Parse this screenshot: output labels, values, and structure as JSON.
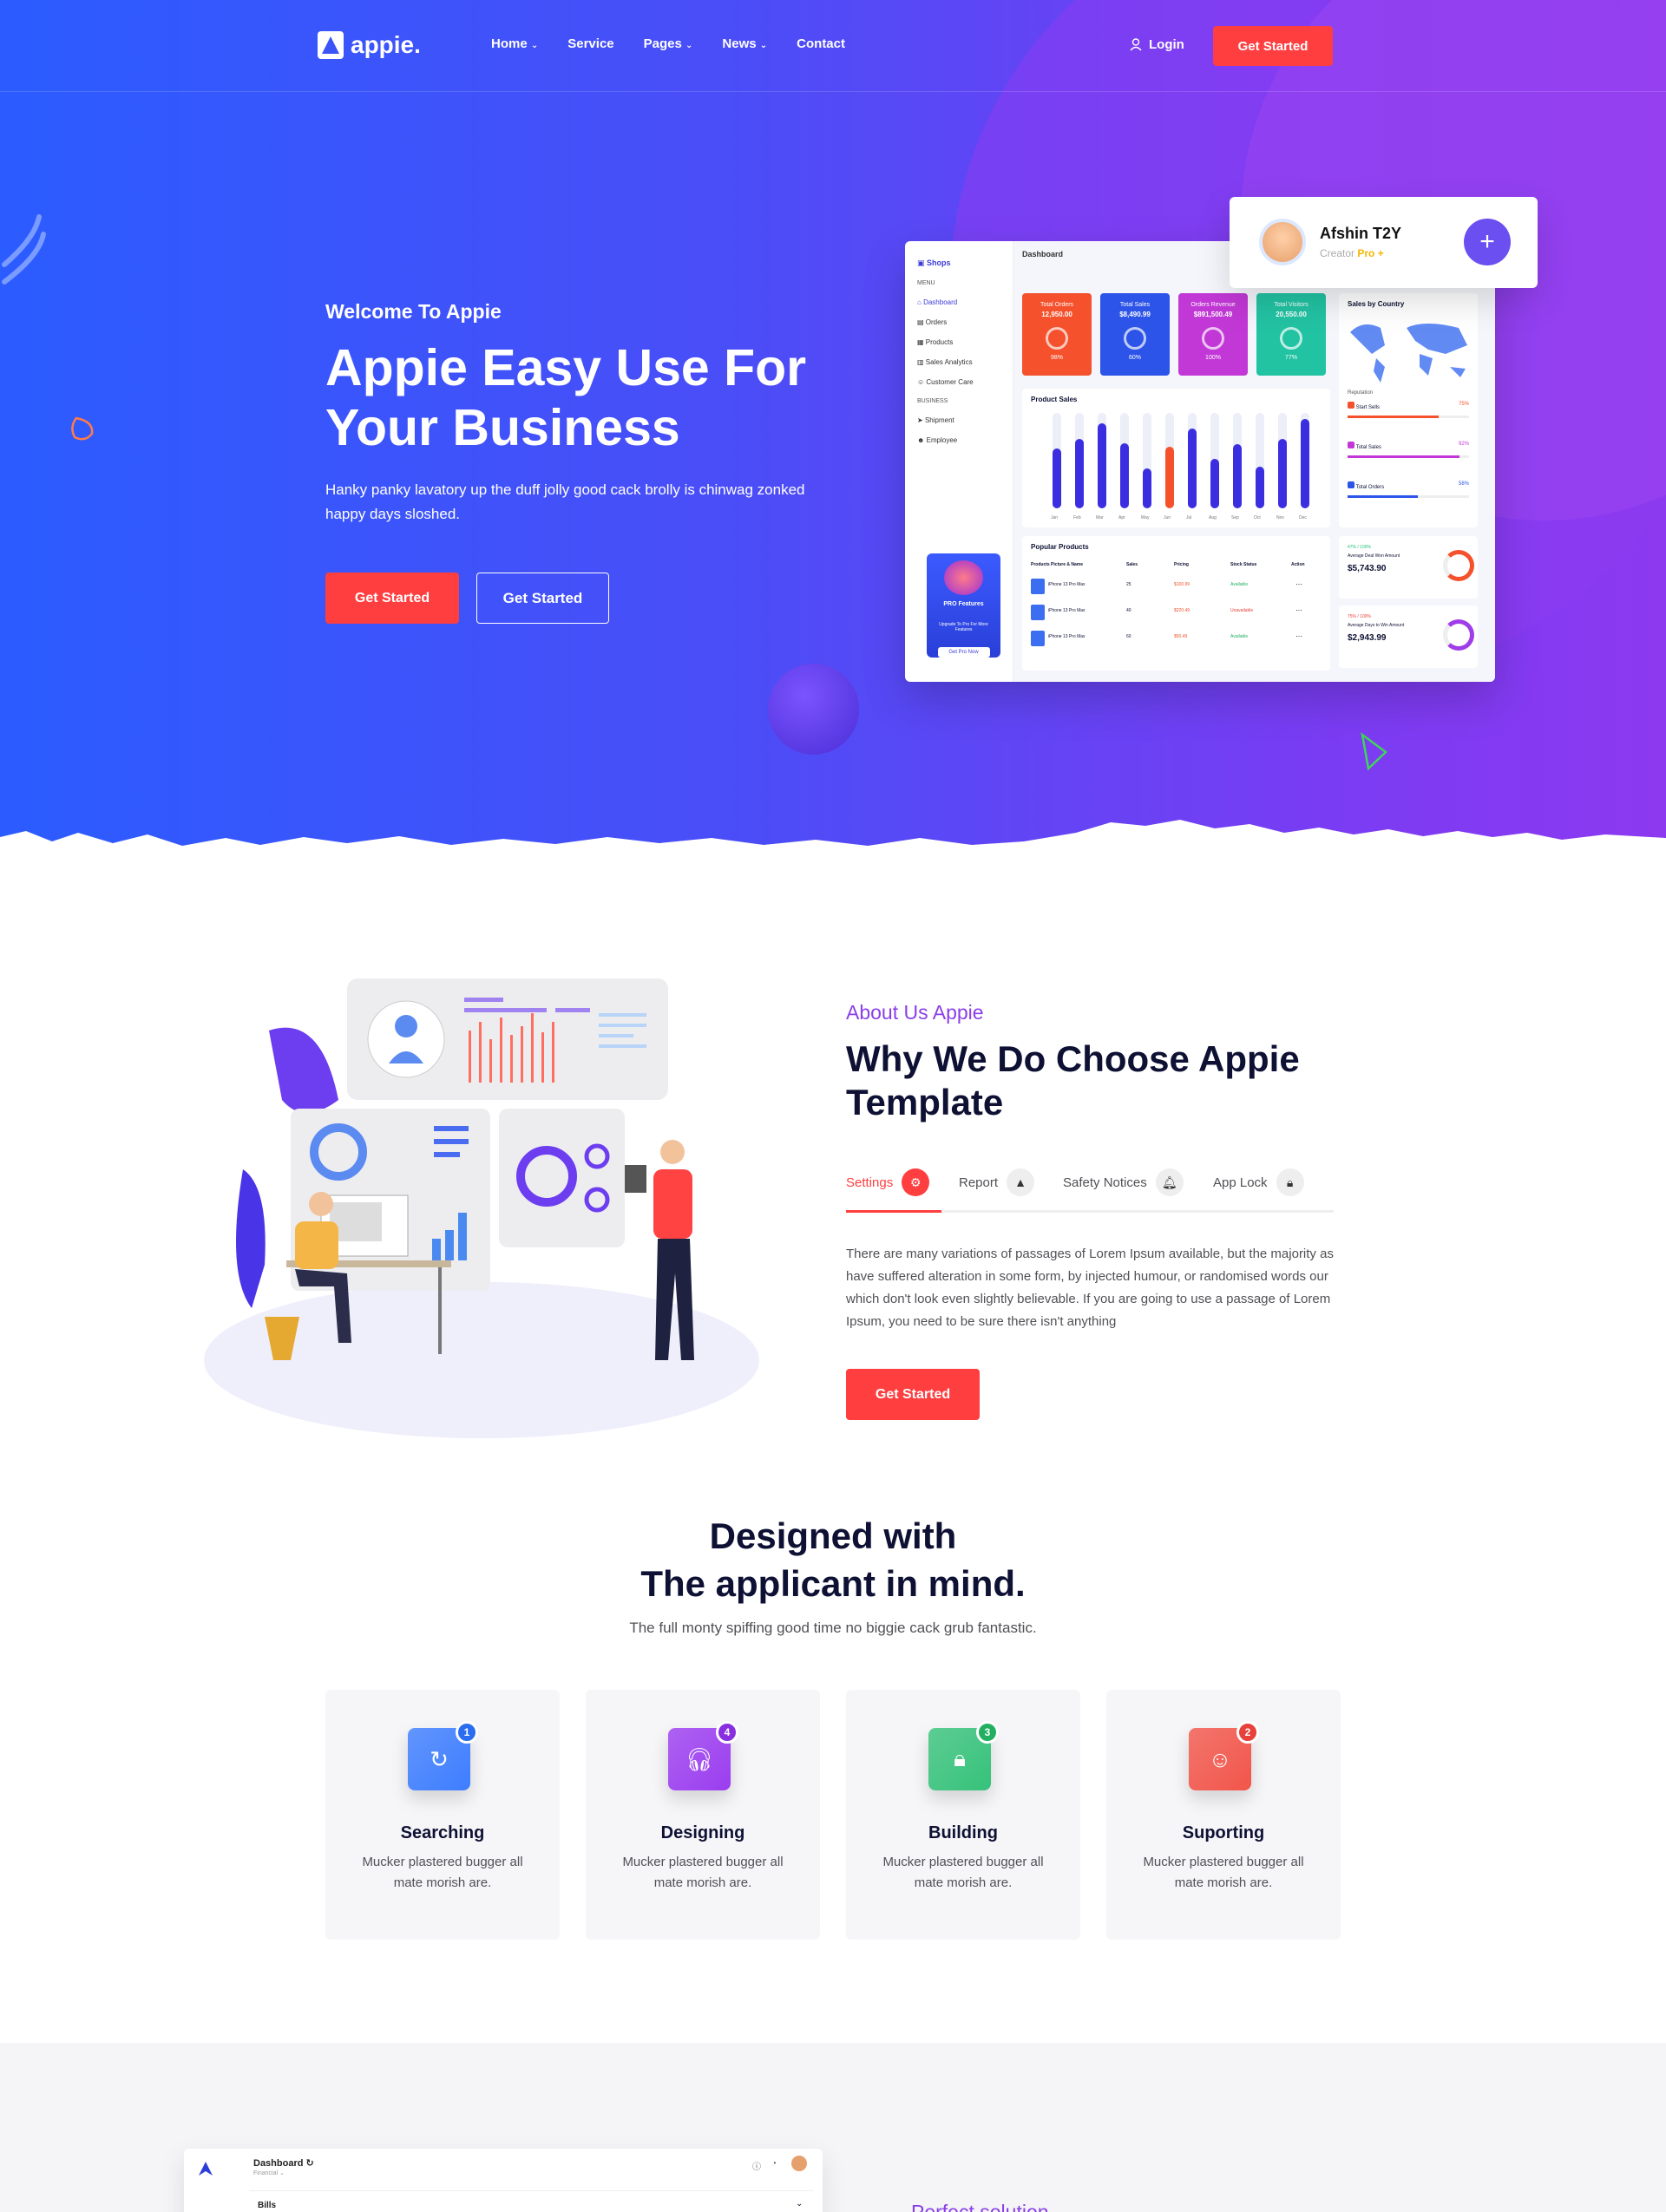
{
  "nav": {
    "logo": "appie.",
    "items": [
      {
        "label": "Home",
        "caret": true
      },
      {
        "label": "Service",
        "caret": false
      },
      {
        "label": "Pages",
        "caret": true
      },
      {
        "label": "News",
        "caret": true
      },
      {
        "label": "Contact",
        "caret": false
      }
    ],
    "login": "Login",
    "cta": "Get Started"
  },
  "hero": {
    "subtitle": "Welcome To Appie",
    "title": "Appie Easy Use For Your Business",
    "text": "Hanky panky lavatory up the duff jolly good cack brolly is chinwag zonked happy days sloshed.",
    "btn1": "Get Started",
    "btn2": "Get Started"
  },
  "profile": {
    "name": "Afshin T2Y",
    "role": "Creator",
    "badge": "Pro +"
  },
  "dashboard": {
    "brand": "Shops",
    "title": "Dashboard",
    "menu_label": "MENU",
    "menu": [
      "Dashboard",
      "Orders",
      "Products",
      "Sales Analytics",
      "Customer Care"
    ],
    "business_label": "BUSINESS",
    "business": [
      "Shipment",
      "Employee"
    ],
    "pro_title": "PRO Features",
    "pro_text": "Upgrade To Pro For More Features",
    "pro_btn": "Get Pro Now",
    "stats": [
      {
        "label": "Total Orders",
        "value": "12,950.00",
        "pct": "98%",
        "color": "#f4512c"
      },
      {
        "label": "Total Sales",
        "value": "$8,490.99",
        "pct": "60%",
        "color": "#2d54e8"
      },
      {
        "label": "Orders Revenue",
        "value": "$891,500.49",
        "pct": "100%",
        "color": "#c238d6"
      },
      {
        "label": "Total Visitors",
        "value": "20,550.00",
        "pct": "77%",
        "color": "#22c3a3"
      }
    ],
    "product_sales": "Product Sales",
    "months": [
      "Jan",
      "Feb",
      "Mar",
      "Apr",
      "May",
      "Jun",
      "Jul",
      "Aug",
      "Sep",
      "Oct",
      "Nov",
      "Dec"
    ],
    "bars": [
      60,
      70,
      85,
      65,
      40,
      62,
      80,
      50,
      64,
      42,
      70,
      90
    ],
    "sales_country": "Sales by Country",
    "reputation": "Reputation",
    "legend": [
      {
        "label": "Start Sells",
        "pct": "75%",
        "color": "#f4512c"
      },
      {
        "label": "Total Sales",
        "pct": "92%",
        "color": "#c238d6"
      },
      {
        "label": "Total Orders",
        "pct": "58%",
        "color": "#2d54e8"
      }
    ],
    "popular": "Popular Products",
    "cols": [
      "Products Picture & Name",
      "Sales",
      "Pricing",
      "Stock Status",
      "Action"
    ],
    "products": [
      {
        "name": "iPhone 13 Pro Max",
        "sales": "25",
        "price": "$100.99",
        "stock": "Available"
      },
      {
        "name": "iPhone 13 Pro Max",
        "sales": "40",
        "price": "$220.49",
        "stock": "Unavailable"
      },
      {
        "name": "iPhone 13 Pro Max",
        "sales": "60",
        "price": "$50.49",
        "stock": "Available"
      }
    ],
    "deal1": {
      "label": "Average Deal Won Amount",
      "value": "$5,743.90",
      "pct": "47% / 100%"
    },
    "deal2": {
      "label": "Average Days to Win Amount",
      "value": "$2,943.99",
      "pct": "75% / 100%"
    }
  },
  "about": {
    "subtitle": "About Us Appie",
    "title": "Why We Do Choose Appie Template",
    "tabs": [
      {
        "label": "Settings",
        "icon": "gear-icon"
      },
      {
        "label": "Report",
        "icon": "warning-icon"
      },
      {
        "label": "Safety Notices",
        "icon": "bell-icon"
      },
      {
        "label": "App Lock",
        "icon": "lock-icon"
      }
    ],
    "text": "There are many variations of passages of Lorem Ipsum available, but the majority as have suffered alteration in some form, by injected humour, or randomised words our which don't look even slightly believable. If you are going to use a passage of Lorem Ipsum, you need to be sure there isn't anything",
    "btn": "Get Started"
  },
  "features": {
    "title_line1": "Designed with",
    "title_line2": "The applicant in mind.",
    "subtitle": "The full monty spiffing good time no biggie cack grub fantastic.",
    "cards": [
      {
        "title": "Searching",
        "text": "Mucker plastered bugger all mate morish are.",
        "num": "1",
        "icon": "refresh-icon",
        "color": "#3d7dff",
        "num_color": "#2b6df0"
      },
      {
        "title": "Designing",
        "text": "Mucker plastered bugger all mate morish are.",
        "num": "4",
        "icon": "headphones-icon",
        "color": "#9b3df0",
        "num_color": "#8a2fe0"
      },
      {
        "title": "Building",
        "text": "Mucker plastered bugger all mate morish are.",
        "num": "3",
        "icon": "lock-icon",
        "color": "#36c27a",
        "num_color": "#22b060"
      },
      {
        "title": "Suporting",
        "text": "Mucker plastered bugger all mate morish are.",
        "num": "2",
        "icon": "smile-icon",
        "color": "#f2554a",
        "num_color": "#e8403a"
      }
    ]
  },
  "bottom": {
    "dash_title": "Dashboard",
    "dash_sub": "Financial",
    "bills": "Bills",
    "perfect": "Perfect solution"
  }
}
